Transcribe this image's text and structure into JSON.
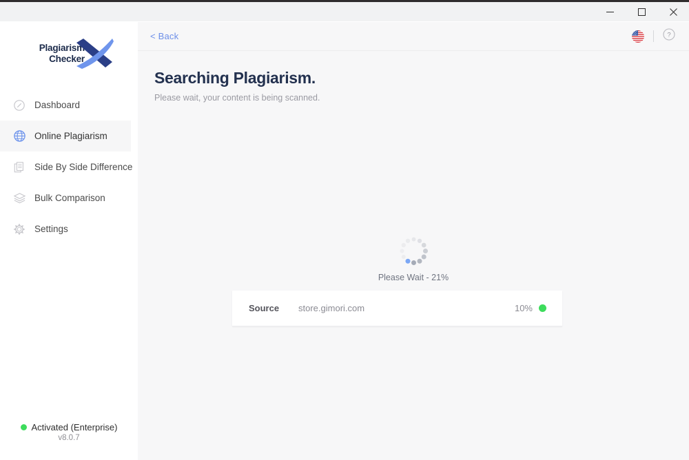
{
  "window": {
    "controls": {
      "minimize_label": "Minimize",
      "maximize_label": "Maximize",
      "close_label": "Close"
    }
  },
  "sidebar": {
    "logo": {
      "line1": "Plagiarism",
      "line2": "Checker",
      "mark": "X"
    },
    "items": [
      {
        "label": "Dashboard",
        "icon": "gauge-icon",
        "active": false
      },
      {
        "label": "Online Plagiarism",
        "icon": "globe-icon",
        "active": true
      },
      {
        "label": "Side By Side Difference",
        "icon": "documents-icon",
        "active": false
      },
      {
        "label": "Bulk Comparison",
        "icon": "layers-icon",
        "active": false
      },
      {
        "label": "Settings",
        "icon": "gear-icon",
        "active": false
      }
    ],
    "status": {
      "text": "Activated (Enterprise)",
      "version": "v8.0.7",
      "dot_color": "#3ddc5c"
    }
  },
  "header": {
    "back_label": "< Back",
    "flag_icon": "us-flag-icon",
    "help_icon": "help-circle-icon"
  },
  "main": {
    "title": "Searching Plagiarism.",
    "subtitle": "Please wait, your content is being scanned.",
    "loader": {
      "spinner_icon": "spinner-dots-icon",
      "progress_text": "Please Wait - 21%",
      "progress_percent": 21,
      "accent_color": "#7ba7f5"
    },
    "source_card": {
      "label": "Source",
      "url": "store.gimori.com",
      "percent": "10%",
      "dot_color": "#3ddc5c"
    }
  }
}
